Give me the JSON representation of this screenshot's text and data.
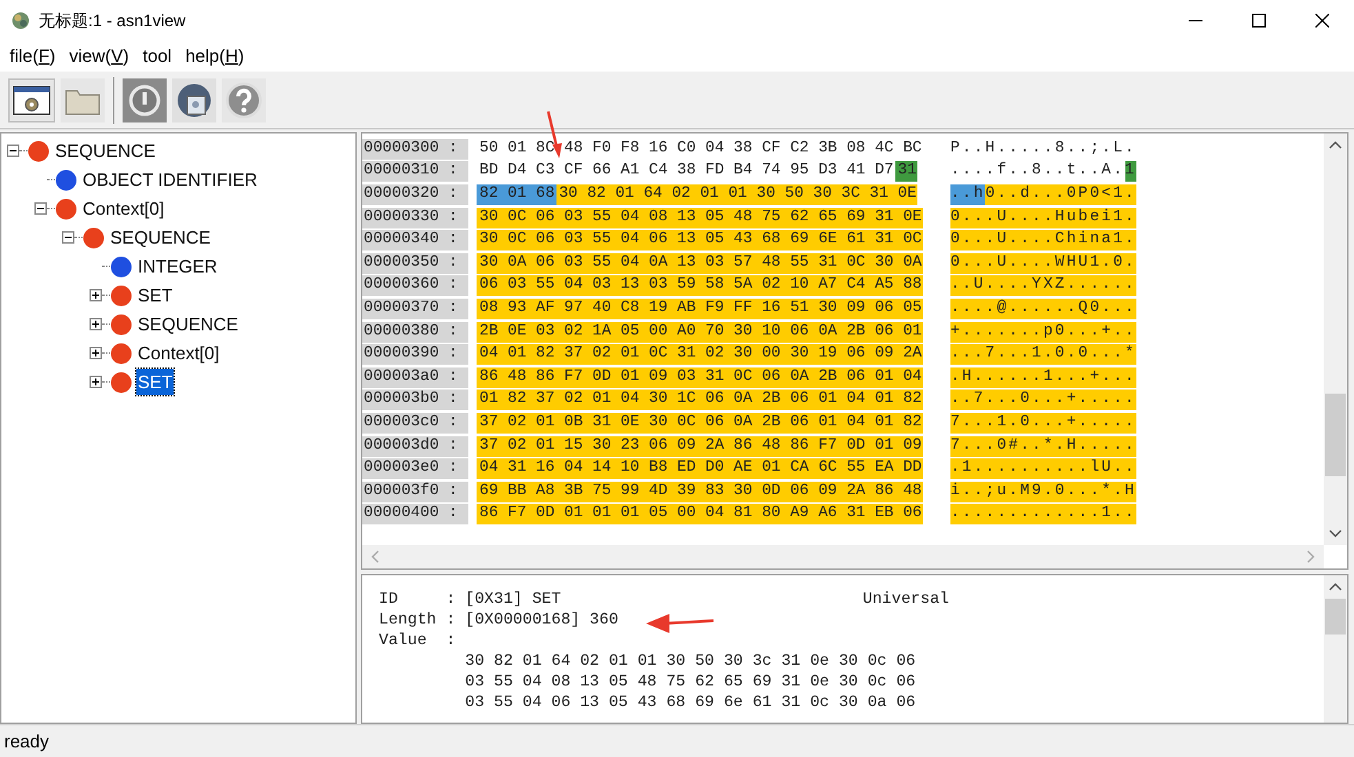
{
  "window": {
    "title": "无标题:1 - asn1view"
  },
  "menu": [
    {
      "label": "file(F)",
      "mnemonic": true
    },
    {
      "label": "view(V)",
      "mnemonic": true
    },
    {
      "label": "tool",
      "mnemonic": false
    },
    {
      "label": "help(H)",
      "mnemonic": true
    }
  ],
  "tree": [
    {
      "label": "SEQUENCE",
      "color": "#e8401c",
      "expanded": true,
      "selected": false,
      "children": [
        {
          "label": "OBJECT IDENTIFIER",
          "color": "#1f4fe0",
          "selected": false
        },
        {
          "label": "Context[0]",
          "color": "#e8401c",
          "expanded": true,
          "selected": false,
          "children": [
            {
              "label": "SEQUENCE",
              "color": "#e8401c",
              "expanded": true,
              "selected": false,
              "children": [
                {
                  "label": "INTEGER",
                  "color": "#1f4fe0",
                  "selected": false
                },
                {
                  "label": "SET",
                  "color": "#e8401c",
                  "expanded": false,
                  "selected": false
                },
                {
                  "label": "SEQUENCE",
                  "color": "#e8401c",
                  "expanded": false,
                  "selected": false
                },
                {
                  "label": "Context[0]",
                  "color": "#e8401c",
                  "expanded": false,
                  "selected": false
                },
                {
                  "label": "SET",
                  "color": "#e8401c",
                  "expanded": false,
                  "selected": true
                }
              ]
            }
          ]
        }
      ]
    }
  ],
  "hex_rows": [
    {
      "address": "00000300 :",
      "bytes": [
        {
          "kind": "plain",
          "text": "50 01 8C 48 F0 F8 16 C0 04 38 CF C2 3B 08 4C BC"
        }
      ],
      "ascii": [
        {
          "kind": "plain",
          "text": "P..H.....8..;.L."
        }
      ]
    },
    {
      "address": "00000310 :",
      "bytes": [
        {
          "kind": "plain",
          "text": "BD D4 C3 CF 66 A1 C4 38 FD B4 74 95 D3 41 D7"
        },
        {
          "kind": "tag",
          "text": "31"
        }
      ],
      "ascii": [
        {
          "kind": "plain",
          "text": "....f..8..t..A."
        },
        {
          "kind": "tag",
          "text": "1"
        }
      ]
    },
    {
      "address": "00000320 :",
      "bytes": [
        {
          "kind": "length",
          "text": "82 01 68"
        },
        {
          "kind": "value",
          "text": "30 82 01 64 02 01 01 30 50 30 3C 31 0E"
        }
      ],
      "ascii": [
        {
          "kind": "length",
          "text": "..h"
        },
        {
          "kind": "value",
          "text": "0..d...0P0<1."
        }
      ]
    },
    {
      "address": "00000330 :",
      "bytes": [
        {
          "kind": "value",
          "text": "30 0C 06 03 55 04 08 13 05 48 75 62 65 69 31 0E"
        }
      ],
      "ascii": [
        {
          "kind": "value",
          "text": "0...U....Hubei1."
        }
      ]
    },
    {
      "address": "00000340 :",
      "bytes": [
        {
          "kind": "value",
          "text": "30 0C 06 03 55 04 06 13 05 43 68 69 6E 61 31 0C"
        }
      ],
      "ascii": [
        {
          "kind": "value",
          "text": "0...U....China1."
        }
      ]
    },
    {
      "address": "00000350 :",
      "bytes": [
        {
          "kind": "value",
          "text": "30 0A 06 03 55 04 0A 13 03 57 48 55 31 0C 30 0A"
        }
      ],
      "ascii": [
        {
          "kind": "value",
          "text": "0...U....WHU1.0."
        }
      ]
    },
    {
      "address": "00000360 :",
      "bytes": [
        {
          "kind": "value",
          "text": "06 03 55 04 03 13 03 59 58 5A 02 10 A7 C4 A5 88"
        }
      ],
      "ascii": [
        {
          "kind": "value",
          "text": "..U....YXZ......"
        }
      ]
    },
    {
      "address": "00000370 :",
      "bytes": [
        {
          "kind": "value",
          "text": "08 93 AF 97 40 C8 19 AB F9 FF 16 51 30 09 06 05"
        }
      ],
      "ascii": [
        {
          "kind": "value",
          "text": "....@......Q0..."
        }
      ]
    },
    {
      "address": "00000380 :",
      "bytes": [
        {
          "kind": "value",
          "text": "2B 0E 03 02 1A 05 00 A0 70 30 10 06 0A 2B 06 01"
        }
      ],
      "ascii": [
        {
          "kind": "value",
          "text": "+.......p0...+.."
        }
      ]
    },
    {
      "address": "00000390 :",
      "bytes": [
        {
          "kind": "value",
          "text": "04 01 82 37 02 01 0C 31 02 30 00 30 19 06 09 2A"
        }
      ],
      "ascii": [
        {
          "kind": "value",
          "text": "...7...1.0.0...*"
        }
      ]
    },
    {
      "address": "000003a0 :",
      "bytes": [
        {
          "kind": "value",
          "text": "86 48 86 F7 0D 01 09 03 31 0C 06 0A 2B 06 01 04"
        }
      ],
      "ascii": [
        {
          "kind": "value",
          "text": ".H......1...+..."
        }
      ]
    },
    {
      "address": "000003b0 :",
      "bytes": [
        {
          "kind": "value",
          "text": "01 82 37 02 01 04 30 1C 06 0A 2B 06 01 04 01 82"
        }
      ],
      "ascii": [
        {
          "kind": "value",
          "text": "..7...0...+....."
        }
      ]
    },
    {
      "address": "000003c0 :",
      "bytes": [
        {
          "kind": "value",
          "text": "37 02 01 0B 31 0E 30 0C 06 0A 2B 06 01 04 01 82"
        }
      ],
      "ascii": [
        {
          "kind": "value",
          "text": "7...1.0...+....."
        }
      ]
    },
    {
      "address": "000003d0 :",
      "bytes": [
        {
          "kind": "value",
          "text": "37 02 01 15 30 23 06 09 2A 86 48 86 F7 0D 01 09"
        }
      ],
      "ascii": [
        {
          "kind": "value",
          "text": "7...0#..*.H....."
        }
      ]
    },
    {
      "address": "000003e0 :",
      "bytes": [
        {
          "kind": "value",
          "text": "04 31 16 04 14 10 B8 ED D0 AE 01 CA 6C 55 EA DD"
        }
      ],
      "ascii": [
        {
          "kind": "value",
          "text": ".1..........lU.."
        }
      ]
    },
    {
      "address": "000003f0 :",
      "bytes": [
        {
          "kind": "value",
          "text": "69 BB A8 3B 75 99 4D 39 83 30 0D 06 09 2A 86 48"
        }
      ],
      "ascii": [
        {
          "kind": "value",
          "text": "i..;u.M9.0...*.H"
        }
      ]
    },
    {
      "address": "00000400 :",
      "bytes": [
        {
          "kind": "value",
          "text": "86 F7 0D 01 01 01 05 00 04 81 80 A9 A6 31 EB 06"
        }
      ],
      "ascii": [
        {
          "kind": "value",
          "text": ".............1.."
        }
      ]
    }
  ],
  "detail": {
    "lines": [
      {
        "text": "ID     : [0X31] SET",
        "tag_class": "Universal"
      },
      {
        "text": "Length : [0X00000168] 360"
      },
      {
        "text": "Value  :"
      },
      {
        "text": "         30 82 01 64 02 01 01 30 50 30 3c 31 0e 30 0c 06"
      },
      {
        "text": "         03 55 04 08 13 05 48 75 62 65 69 31 0e 30 0c 06"
      },
      {
        "text": "         03 55 04 06 13 05 43 68 69 6e 61 31 0c 30 0a 06"
      }
    ]
  },
  "status_bar": "ready"
}
